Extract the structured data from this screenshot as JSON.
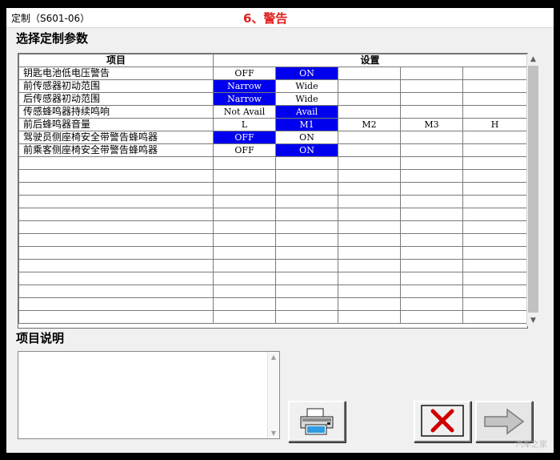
{
  "window": {
    "title": "定制（S601-06）",
    "annotation": "6、警告"
  },
  "params_section": {
    "label": "选择定制参数"
  },
  "grid": {
    "headers": {
      "item": "项目",
      "setting": "设置"
    },
    "rows": [
      {
        "item": "钥匙电池低电压警告",
        "options": [
          "OFF",
          "ON",
          "",
          "",
          ""
        ],
        "selected": 1
      },
      {
        "item": "前传感器初动范围",
        "options": [
          "Narrow",
          "Wide",
          "",
          "",
          ""
        ],
        "selected": 0
      },
      {
        "item": "后传感器初动范围",
        "options": [
          "Narrow",
          "Wide",
          "",
          "",
          ""
        ],
        "selected": 0
      },
      {
        "item": "传感蜂鸣器持续鸣响",
        "options": [
          "Not Avail",
          "Avail",
          "",
          "",
          ""
        ],
        "selected": 1
      },
      {
        "item": "前后蜂鸣器音量",
        "options": [
          "L",
          "M1",
          "M2",
          "M3",
          "H"
        ],
        "selected": 1
      },
      {
        "item": "驾驶员侧座椅安全带警告蜂鸣器",
        "options": [
          "OFF",
          "ON",
          "",
          "",
          ""
        ],
        "selected": 0
      },
      {
        "item": "前乘客侧座椅安全带警告蜂鸣器",
        "options": [
          "OFF",
          "ON",
          "",
          "",
          ""
        ],
        "selected": 1
      }
    ],
    "empty_rows": 13
  },
  "description_section": {
    "label": "项目说明",
    "text": ""
  },
  "buttons": {
    "print": {
      "icon": "printer-icon"
    },
    "cancel": {
      "icon": "red-x-icon"
    },
    "next": {
      "icon": "right-arrow-icon"
    }
  },
  "colors": {
    "selected_cell": "#0000ee",
    "annotation": "#e02020"
  },
  "corner_mark": "汽车之家"
}
